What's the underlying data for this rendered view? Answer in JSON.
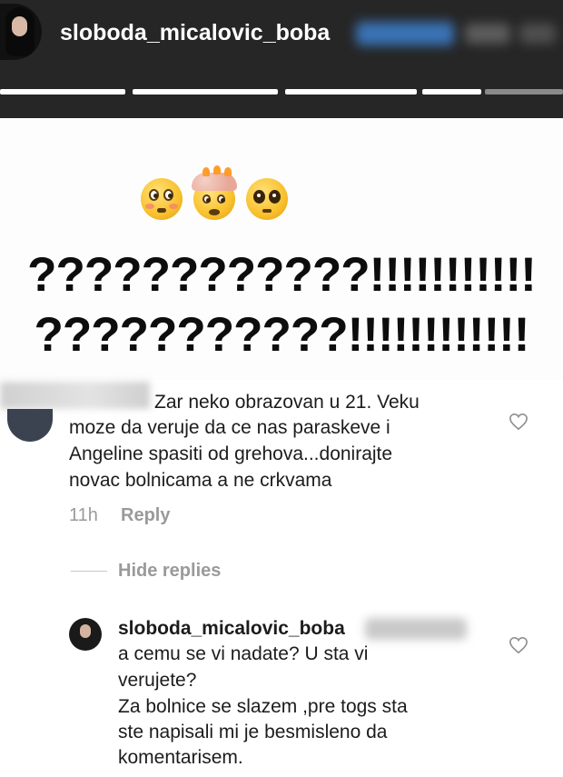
{
  "story": {
    "username": "sloboda_micalovic_boba",
    "progress_segments": 5,
    "emojis": [
      "flushed-face-emoji",
      "exploding-head-emoji",
      "pleading-face-emoji"
    ],
    "text_line1": "????????????!!!!!!!!!!!",
    "text_line2": "???????????!!!!!!!!!!!!"
  },
  "comment": {
    "text_lines": [
      "Zar neko obrazovan  u 21. Veku",
      "moze da veruje da ce nas paraskeve  i",
      "Angeline spasiti od grehova...donirajte",
      "novac bolnicama a ne crkvama"
    ],
    "time": "11h",
    "reply_label": "Reply",
    "hide_replies_label": "Hide replies"
  },
  "reply": {
    "username": "sloboda_micalovic_boba",
    "text_lines": [
      "a cemu se vi nadate? U sta vi",
      "verujete?",
      "Za bolnice se slazem ,pre togs sta",
      "ste napisali mi je besmisleno da",
      "komentarisem."
    ]
  },
  "colors": {
    "header_bg": "#262626",
    "text": "#1c1c1c",
    "muted": "#9a9a9a"
  }
}
